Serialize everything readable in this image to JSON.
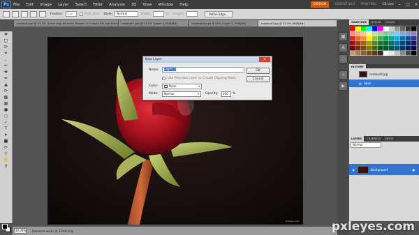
{
  "menubar": {
    "logo": "Ps",
    "items": [
      "File",
      "Edit",
      "Image",
      "Layer",
      "Select",
      "Filter",
      "Analysis",
      "3D",
      "View",
      "Window",
      "Help"
    ],
    "workspaces": [
      "DESIGN",
      "ESSENTIALS",
      "PAINTING"
    ],
    "active_workspace": "DESIGN",
    "cs_live": "CS Live"
  },
  "options_bar": {
    "feather_label": "Feather:",
    "feather_value": "0 px",
    "antialias_label": "Anti-alias",
    "style_label": "Style:",
    "style_value": "Normal",
    "width_label": "Width:",
    "height_label": "Height:",
    "refine_button": "Refine Edge..."
  },
  "doc_tabs": [
    "rosebud.psd @ 33.3% (There may be many flowers in a rose's life, but there is on, RGB/8#)",
    "rosebud3.psd @ 33.3% (Layer 4, RGB/8#)",
    "rosebuddo.psd @ 25% (Layer 4, RGB/8#)",
    "rosebud3.jpg @ 33.3% (RGB/8#)"
  ],
  "active_doc_tab": 3,
  "status": {
    "zoom": "33.33%",
    "message": "Exposure works in 32-bit only"
  },
  "canvas": {
    "credit": "pxleyes.com"
  },
  "dialog": {
    "title": "New Layer",
    "name_label": "Name:",
    "name_value": "Layer 1",
    "clip_label": "Use Previous Layer to Create Clipping Mask",
    "color_label": "Color:",
    "color_value": "None",
    "mode_label": "Mode:",
    "mode_value": "Normal",
    "opacity_label": "Opacity:",
    "opacity_value": "100",
    "opacity_unit": "%",
    "ok": "OK",
    "cancel": "Cancel"
  },
  "panels": {
    "swatch_tabs": [
      "SWATCHES",
      "STYLES",
      "COLOR"
    ],
    "history_title": "HISTORY",
    "history_items": [
      "rosebud3.jpg",
      "Open"
    ],
    "layers_tabs": [
      "LAYERS",
      "CHANNELS",
      "PATHS"
    ],
    "blend_mode": "Normal",
    "layer_name": "Background"
  },
  "swatch_colors": [
    "#ff0000",
    "#ffff00",
    "#00ff00",
    "#00ffff",
    "#0000ff",
    "#ff00ff",
    "#ffffff",
    "#cccccc",
    "#999999",
    "#666666",
    "#333333",
    "#000000",
    "#f7977a",
    "#f9ad81",
    "#fdc68a",
    "#fff79a",
    "#c4df9b",
    "#a2d39c",
    "#82ca9d",
    "#7bcdc8",
    "#6ecff6",
    "#7ea7d8",
    "#8493ca",
    "#8882be",
    "#ed1c24",
    "#f26522",
    "#f7941d",
    "#fff200",
    "#8dc73f",
    "#39b54a",
    "#00a651",
    "#00a99d",
    "#00aeef",
    "#0072bc",
    "#0054a6",
    "#2e3192",
    "#9e0b0f",
    "#a0410d",
    "#a36209",
    "#aba000",
    "#598527",
    "#1a7b30",
    "#007236",
    "#00746b",
    "#0076a3",
    "#004b80",
    "#003471",
    "#1b1464",
    "#790000",
    "#7b2e00",
    "#7d4900",
    "#827b00",
    "#406618",
    "#005e20",
    "#005826",
    "#005952",
    "#005b7f",
    "#003663",
    "#002157",
    "#0d004c",
    "#c69c6d",
    "#a67c52",
    "#8c6239",
    "#754c24",
    "#603913",
    "#3c2415",
    "#ffffff",
    "#e5e5e5",
    "#bfbfbf",
    "#8a8a8a",
    "#454545",
    "#000000"
  ],
  "watermark": "pxleyes.com"
}
